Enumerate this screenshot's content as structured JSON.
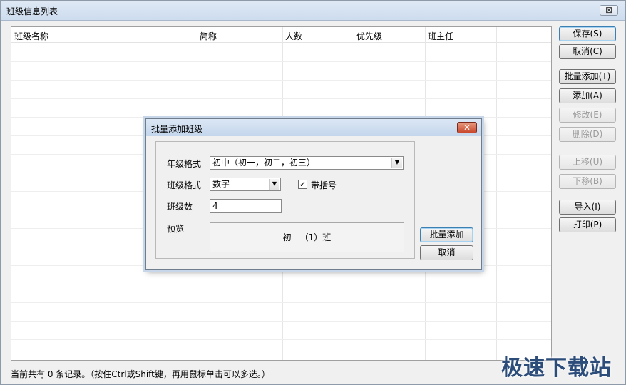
{
  "window": {
    "title": "班级信息列表",
    "close_label": "⊠"
  },
  "grid": {
    "columns": [
      "班级名称",
      "简称",
      "人数",
      "优先级",
      "班主任"
    ]
  },
  "side_buttons": {
    "save": "保存(S)",
    "cancel": "取消(C)",
    "batch_add": "批量添加(T)",
    "add": "添加(A)",
    "edit": "修改(E)",
    "delete": "删除(D)",
    "move_up": "上移(U)",
    "move_down": "下移(B)",
    "import": "导入(I)",
    "print": "打印(P)"
  },
  "status": {
    "text": "当前共有 0 条记录。（按住Ctrl或Shift键，再用鼠标单击可以多选。）"
  },
  "watermark": {
    "text": "极速下载站"
  },
  "dialog": {
    "title": "批量添加班级",
    "close_label": "✕",
    "grade_format_label": "年级格式",
    "grade_format_value": "初中（初一，初二，初三）",
    "class_format_label": "班级格式",
    "class_format_value": "数字",
    "bracket_label": "带括号",
    "bracket_checked_mark": "✓",
    "class_count_label": "班级数",
    "class_count_value": "4",
    "preview_label": "预览",
    "preview_value": "初一（1）班",
    "batch_add_button": "批量添加",
    "cancel_button": "取消"
  },
  "icons": {
    "dropdown": "chevron-down-icon",
    "check": "check-icon"
  }
}
